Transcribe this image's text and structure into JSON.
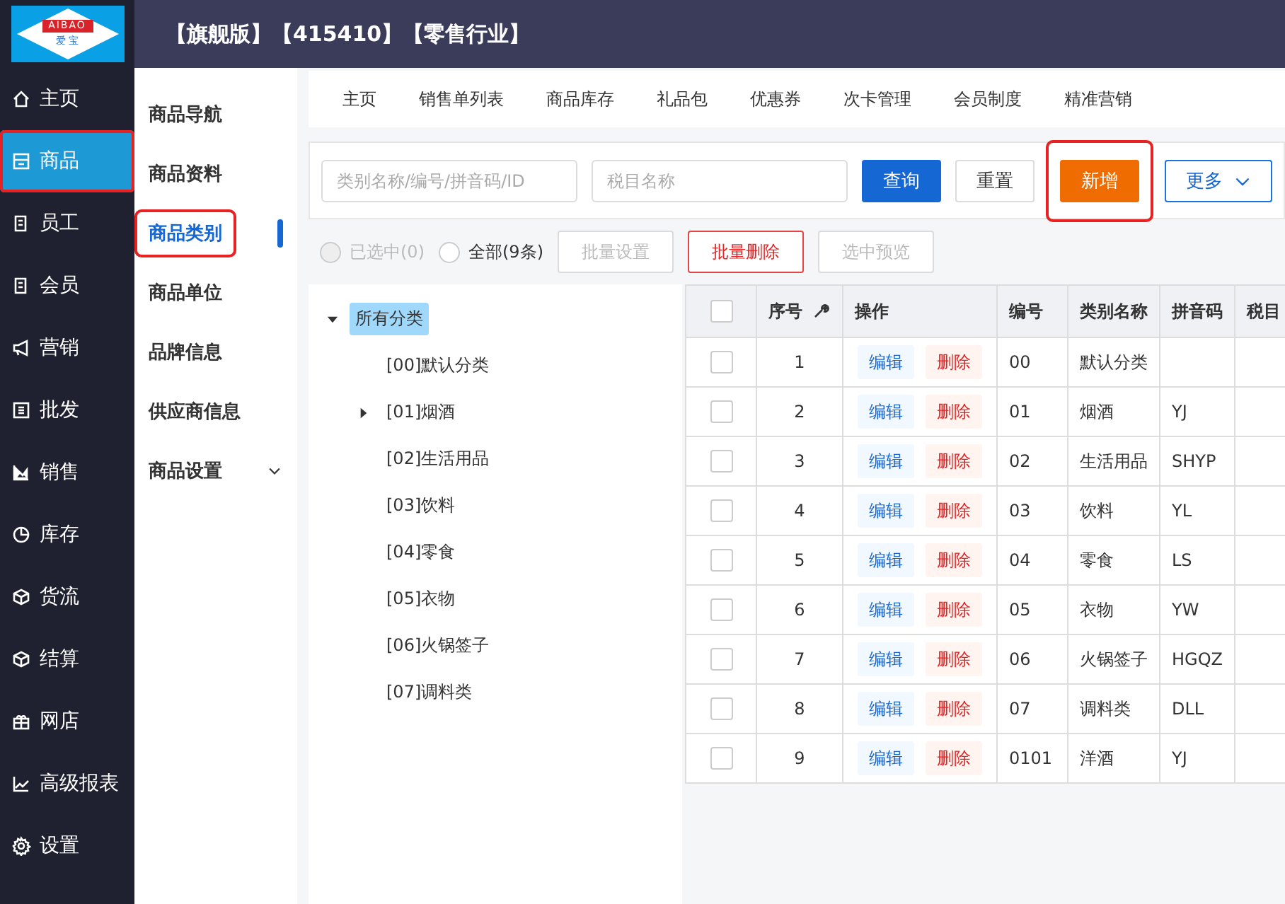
{
  "logo": {
    "brand": "AIBAO",
    "name": "爱 宝"
  },
  "header": {
    "title": "【旗舰版】【415410】【零售行业】"
  },
  "sidebar": {
    "items": [
      {
        "label": "主页",
        "selected": false,
        "annotated": false
      },
      {
        "label": "商品",
        "selected": true,
        "annotated": true
      },
      {
        "label": "员工",
        "selected": false,
        "annotated": false
      },
      {
        "label": "会员",
        "selected": false,
        "annotated": false
      },
      {
        "label": "营销",
        "selected": false,
        "annotated": false
      },
      {
        "label": "批发",
        "selected": false,
        "annotated": false
      },
      {
        "label": "销售",
        "selected": false,
        "annotated": false
      },
      {
        "label": "库存",
        "selected": false,
        "annotated": false
      },
      {
        "label": "货流",
        "selected": false,
        "annotated": false
      },
      {
        "label": "结算",
        "selected": false,
        "annotated": false
      },
      {
        "label": "网店",
        "selected": false,
        "annotated": false
      },
      {
        "label": "高级报表",
        "selected": false,
        "annotated": false
      },
      {
        "label": "设置",
        "selected": false,
        "annotated": false
      }
    ]
  },
  "submenu": {
    "items": [
      {
        "label": "商品导航",
        "selected": false,
        "annotated": false
      },
      {
        "label": "商品资料",
        "selected": false,
        "annotated": false
      },
      {
        "label": "商品类别",
        "selected": true,
        "annotated": true
      },
      {
        "label": "商品单位",
        "selected": false,
        "annotated": false
      },
      {
        "label": "品牌信息",
        "selected": false,
        "annotated": false
      },
      {
        "label": "供应商信息",
        "selected": false,
        "annotated": false
      },
      {
        "label": "商品设置",
        "selected": false,
        "annotated": false,
        "expanded": false
      }
    ]
  },
  "tabs": [
    "主页",
    "销售单列表",
    "商品库存",
    "礼品包",
    "优惠券",
    "次卡管理",
    "会员制度",
    "精准营销"
  ],
  "filter": {
    "fields": [
      {
        "placeholder": "类别名称/编号/拼音码/ID"
      },
      {
        "placeholder": "税目名称"
      }
    ],
    "buttons": [
      {
        "label": "查询",
        "kind": "primary",
        "annotated": false
      },
      {
        "label": "重置",
        "kind": "default",
        "annotated": false
      },
      {
        "label": "新增",
        "kind": "warning",
        "annotated": true
      },
      {
        "label": "更多",
        "kind": "dropdown",
        "annotated": false
      }
    ]
  },
  "bulk": {
    "radios": [
      {
        "label": "已选中(0)",
        "selected": false,
        "disabled": true
      },
      {
        "label": "全部(9条)",
        "selected": false,
        "disabled": false
      }
    ],
    "buttons": [
      {
        "label": "批量设置",
        "kind": "disabled"
      },
      {
        "label": "批量删除",
        "kind": "danger"
      },
      {
        "label": "选中预览",
        "kind": "disabled"
      }
    ]
  },
  "tree": {
    "label": "所有分类",
    "selected": true,
    "expanded": true,
    "children": [
      {
        "label": "[00]默认分类"
      },
      {
        "label": "[01]烟酒",
        "expanded": false
      },
      {
        "label": "[02]生活用品"
      },
      {
        "label": "[03]饮料"
      },
      {
        "label": "[04]零食"
      },
      {
        "label": "[05]衣物"
      },
      {
        "label": "[06]火锅签子"
      },
      {
        "label": "[07]调料类"
      }
    ]
  },
  "table": {
    "header_checked": false,
    "columns": [
      "序号",
      "操作",
      "编号",
      "类别名称",
      "拼音码",
      "税目"
    ],
    "rows": [
      {
        "checked": false,
        "index": "1",
        "actions": [
          "编辑",
          "删除"
        ],
        "code": "00",
        "name": "默认分类",
        "pinyin": ""
      },
      {
        "checked": false,
        "index": "2",
        "actions": [
          "编辑",
          "删除"
        ],
        "code": "01",
        "name": "烟酒",
        "pinyin": "YJ"
      },
      {
        "checked": false,
        "index": "3",
        "actions": [
          "编辑",
          "删除"
        ],
        "code": "02",
        "name": "生活用品",
        "pinyin": "SHYP"
      },
      {
        "checked": false,
        "index": "4",
        "actions": [
          "编辑",
          "删除"
        ],
        "code": "03",
        "name": "饮料",
        "pinyin": "YL"
      },
      {
        "checked": false,
        "index": "5",
        "actions": [
          "编辑",
          "删除"
        ],
        "code": "04",
        "name": "零食",
        "pinyin": "LS"
      },
      {
        "checked": false,
        "index": "6",
        "actions": [
          "编辑",
          "删除"
        ],
        "code": "05",
        "name": "衣物",
        "pinyin": "YW"
      },
      {
        "checked": false,
        "index": "7",
        "actions": [
          "编辑",
          "删除"
        ],
        "code": "06",
        "name": "火锅签子",
        "pinyin": "HGQZ"
      },
      {
        "checked": false,
        "index": "8",
        "actions": [
          "编辑",
          "删除"
        ],
        "code": "07",
        "name": "调料类",
        "pinyin": "DLL"
      },
      {
        "checked": false,
        "index": "9",
        "actions": [
          "编辑",
          "删除"
        ],
        "code": "0101",
        "name": "洋酒",
        "pinyin": "YJ"
      }
    ]
  }
}
